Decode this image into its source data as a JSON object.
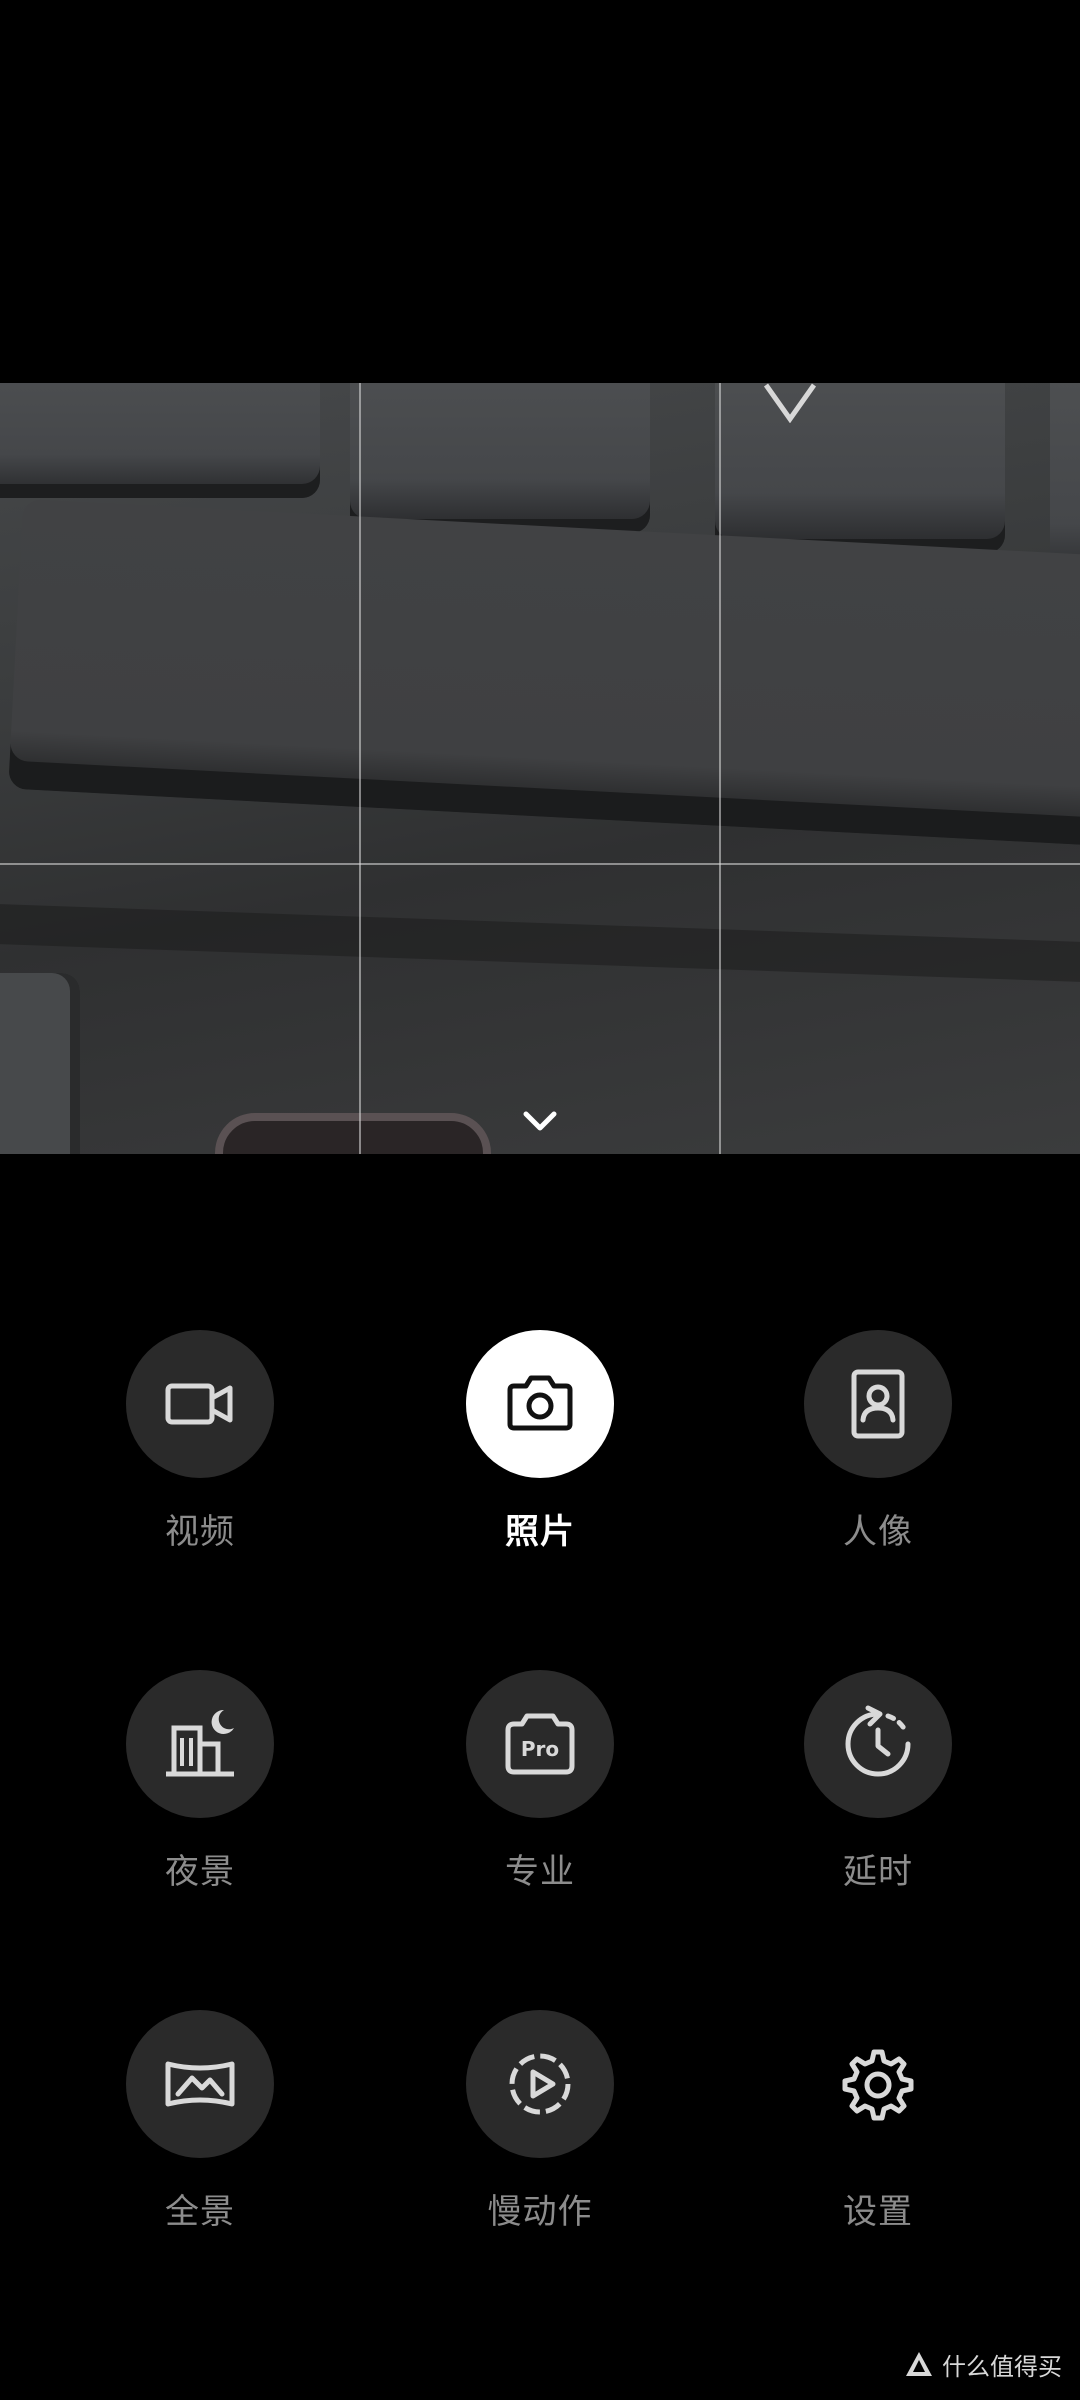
{
  "modes": [
    {
      "key": "video",
      "label": "视频",
      "icon": "video-camera-icon",
      "active": false
    },
    {
      "key": "photo",
      "label": "照片",
      "icon": "camera-icon",
      "active": true
    },
    {
      "key": "portrait",
      "label": "人像",
      "icon": "portrait-icon",
      "active": false
    },
    {
      "key": "night",
      "label": "夜景",
      "icon": "night-scene-icon",
      "active": false
    },
    {
      "key": "pro",
      "label": "专业",
      "icon": "pro-camera-icon",
      "active": false
    },
    {
      "key": "timelapse",
      "label": "延时",
      "icon": "timelapse-icon",
      "active": false
    },
    {
      "key": "panorama",
      "label": "全景",
      "icon": "panorama-icon",
      "active": false
    },
    {
      "key": "slowmo",
      "label": "慢动作",
      "icon": "slow-motion-icon",
      "active": false
    },
    {
      "key": "settings",
      "label": "设置",
      "icon": "gear-icon",
      "active": false
    }
  ],
  "pro_badge_text": "Pro",
  "watermark": {
    "text": "什么值得买"
  },
  "colors": {
    "background": "#000000",
    "inactive_circle": "#2a2a2a",
    "active_circle": "#ffffff",
    "inactive_label": "#8c8c8c",
    "active_label": "#ffffff"
  }
}
